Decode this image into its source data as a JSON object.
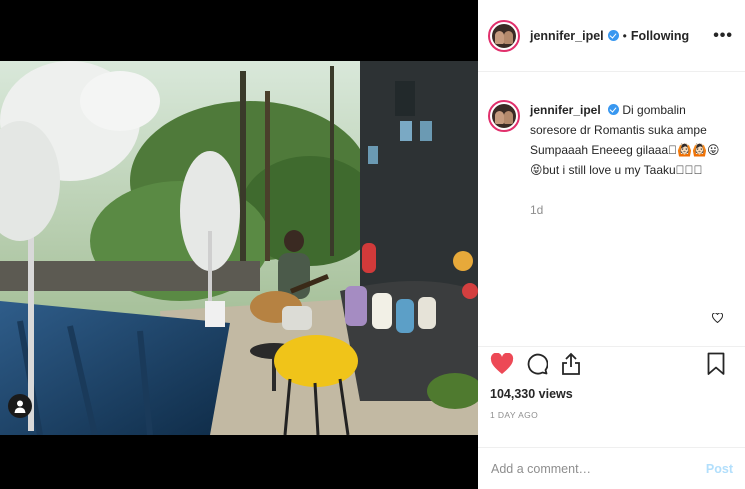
{
  "post": {
    "username": "jennifer_ipel",
    "follow_status": "Following",
    "separator": "•",
    "more_label": "•••",
    "caption_text": "Di gombalin soresore dr Romantis suka ampe Sumpaaah Eneeeg gilaaa🏻🙆🏻🙆🏻😛😝but i still love u my Taaku",
    "caption_emoji": "🏻🏻🏻",
    "age": "1d",
    "views": "104,330 views",
    "timestamp": "1 DAY AGO"
  },
  "comment_box": {
    "placeholder": "Add a comment…",
    "post_label": "Post"
  },
  "colors": {
    "accent_blue": "#3897f0",
    "like_red": "#ed4956",
    "post_disabled": "#b2dffc",
    "muted": "#8e8e8e"
  },
  "icons": [
    "verified-icon",
    "more-options-icon",
    "user-tag-icon",
    "like-icon",
    "comment-icon",
    "share-icon",
    "save-icon",
    "small-heart-icon"
  ]
}
